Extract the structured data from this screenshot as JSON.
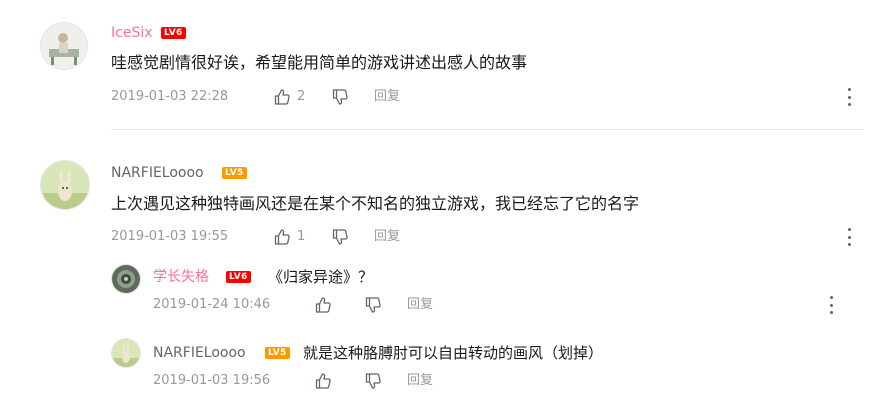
{
  "comments": [
    {
      "user": "IceSix",
      "level": "LV6",
      "level_color": "#ff0000",
      "content": "哇感觉剧情很好诶，希望能用简单的游戏讲述出感人的故事",
      "time": "2019-01-03 22:28",
      "likes": "2",
      "reply_label": "回复",
      "replies": []
    },
    {
      "user": "NARFIELoooo",
      "level": "LV5",
      "level_color": "#ff9900",
      "content": "上次遇见这种独特画风还是在某个不知名的独立游戏，我已经忘了它的名字",
      "time": "2019-01-03 19:55",
      "likes": "1",
      "reply_label": "回复",
      "replies": [
        {
          "user": "学长失格",
          "level": "LV6",
          "level_color": "#ff0000",
          "content": "《归家异途》？",
          "time": "2019-01-24 10:46",
          "reply_label": "回复"
        },
        {
          "user": "NARFIELoooo",
          "level": "LV5",
          "level_color": "#ff9900",
          "content": "就是这种胳膊肘可以自由转动的画风（划掉）",
          "time": "2019-01-03 19:56",
          "reply_label": "回复"
        }
      ]
    }
  ],
  "icons": {
    "like": "thumbs-up-icon",
    "dislike": "thumbs-down-icon",
    "more": "more-vertical-icon"
  },
  "colors": {
    "vip_name": "#fb7299",
    "meta": "#9499a0",
    "divider": "#e3e5e7"
  }
}
